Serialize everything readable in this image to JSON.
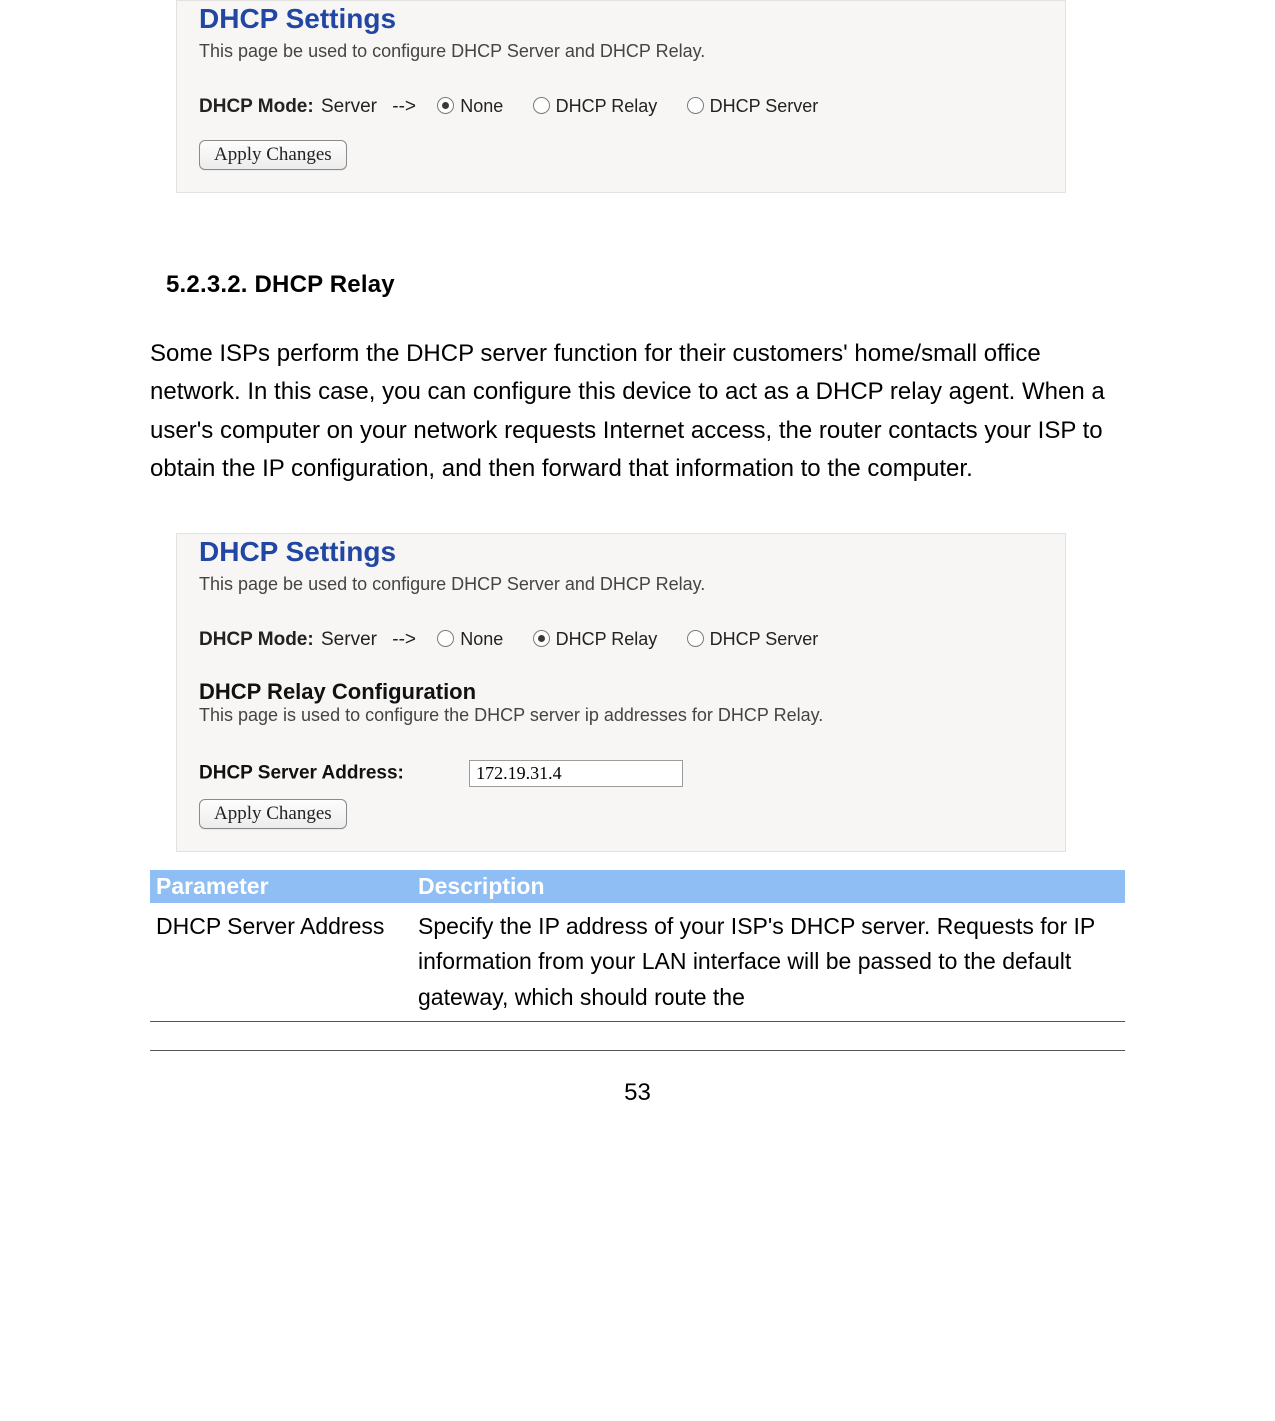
{
  "panel1": {
    "title": "DHCP Settings",
    "description": "This page be used to configure DHCP Server and DHCP Relay.",
    "mode_label": "DHCP Mode:",
    "mode_value": "Server",
    "arrow": "-->",
    "options": {
      "none": "None",
      "relay": "DHCP Relay",
      "server": "DHCP Server",
      "selected": "none"
    },
    "apply_button": "Apply Changes"
  },
  "section": {
    "heading": "5.2.3.2. DHCP Relay",
    "body": "Some ISPs perform the DHCP server function for their customers' home/small office network. In this case, you can configure this device to act as a DHCP relay agent. When a user's computer on your network requests Internet access, the router contacts your ISP to obtain the IP configuration, and then forward that information to the computer."
  },
  "panel2": {
    "title": "DHCP Settings",
    "description": "This page be used to configure DHCP Server and DHCP Relay.",
    "mode_label": "DHCP Mode:",
    "mode_value": "Server",
    "arrow": "-->",
    "options": {
      "none": "None",
      "relay": "DHCP Relay",
      "server": "DHCP Server",
      "selected": "relay"
    },
    "relay_heading": "DHCP Relay Configuration",
    "relay_desc": "This page is used to configure the DHCP server ip addresses for DHCP Relay.",
    "addr_label": "DHCP Server Address:",
    "addr_value": "172.19.31.4",
    "apply_button": "Apply Changes"
  },
  "table": {
    "headers": {
      "param": "Parameter",
      "desc": "Description"
    },
    "rows": [
      {
        "param": "DHCP Server Address",
        "desc": "Specify the IP address of your ISP's DHCP server. Requests for IP information from your LAN interface will be passed to the default gateway, which should route the"
      }
    ]
  },
  "page_number": "53"
}
